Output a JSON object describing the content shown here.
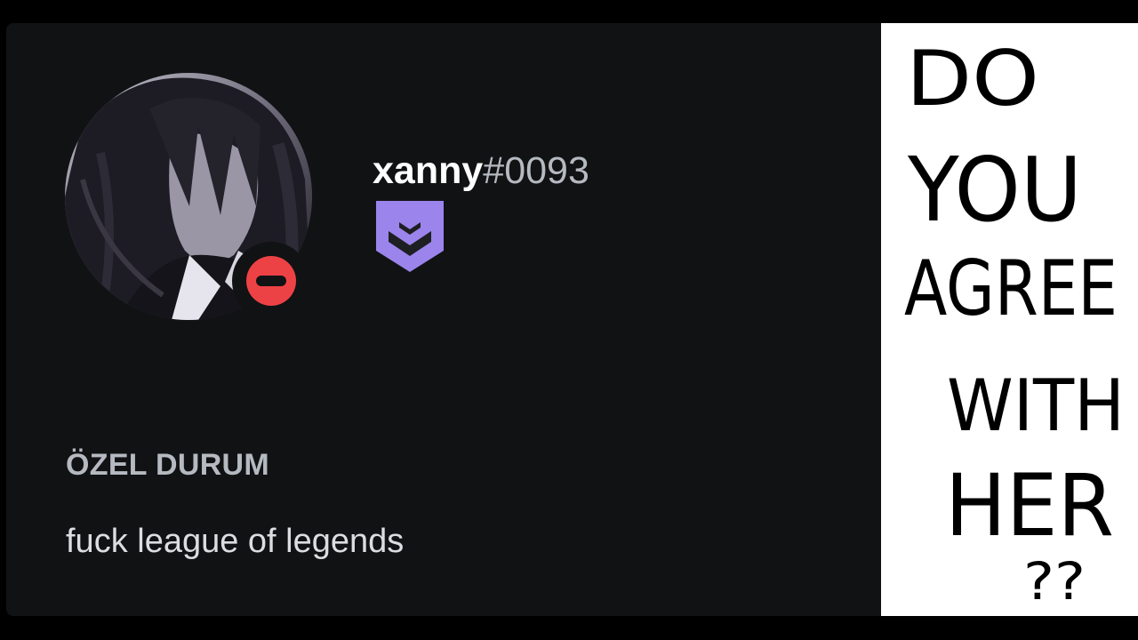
{
  "profile": {
    "username": "xanny",
    "discriminator": "#0093",
    "status": "do-not-disturb",
    "status_color": "#ed4245",
    "badge": {
      "icon": "hypesquad-chevron-badge-icon",
      "color": "#9b84ec"
    },
    "custom_status_label": "ÖZEL DURUM",
    "custom_status_text": "fuck league of legends"
  },
  "meme": {
    "lines": [
      "DO",
      "YOU",
      "AGREE",
      "WITH",
      "HER",
      "??"
    ]
  },
  "colors": {
    "card_bg": "#111214",
    "page_bg": "#000000",
    "panel_bg": "#ffffff"
  }
}
